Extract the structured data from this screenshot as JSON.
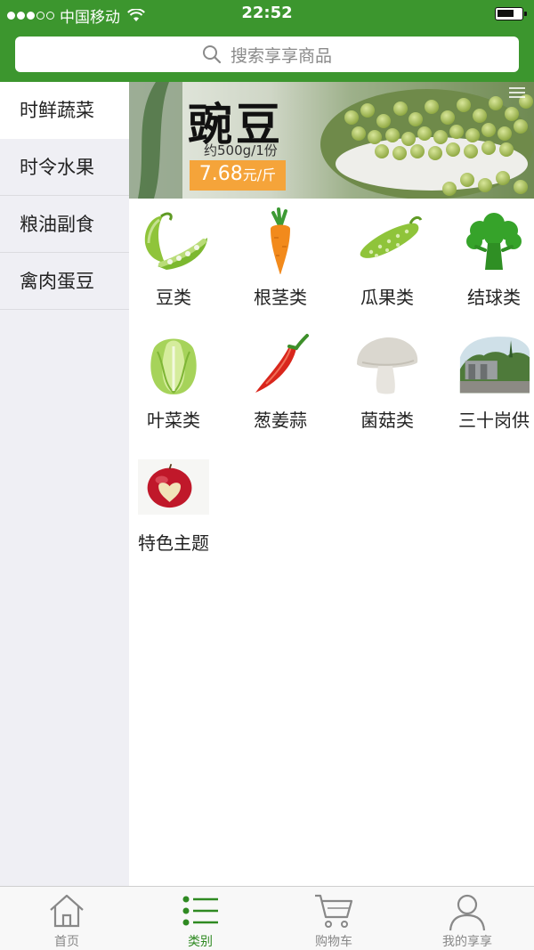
{
  "status_bar": {
    "carrier": "中国移动",
    "time": "22:52"
  },
  "search": {
    "placeholder": "搜索享享商品"
  },
  "sidebar": {
    "items": [
      {
        "label": "时鲜蔬菜",
        "active": true
      },
      {
        "label": "时令水果",
        "active": false
      },
      {
        "label": "粮油副食",
        "active": false
      },
      {
        "label": "禽肉蛋豆",
        "active": false
      }
    ]
  },
  "banner": {
    "title": "豌豆",
    "subtitle": "约500g/1份",
    "price": "7.68",
    "price_unit": "元/斤"
  },
  "categories": [
    {
      "label": "豆类",
      "icon": "pea-pod-icon"
    },
    {
      "label": "根茎类",
      "icon": "carrot-icon"
    },
    {
      "label": "瓜果类",
      "icon": "cucumber-icon"
    },
    {
      "label": "结球类",
      "icon": "broccoli-icon"
    },
    {
      "label": "叶菜类",
      "icon": "cabbage-icon"
    },
    {
      "label": "葱姜蒜",
      "icon": "chili-icon"
    },
    {
      "label": "菌菇类",
      "icon": "mushroom-icon"
    },
    {
      "label": "三十岗供",
      "icon": "village-photo-icon"
    },
    {
      "label": "特色主题",
      "icon": "apple-photo-icon"
    }
  ],
  "tab_bar": {
    "tabs": [
      {
        "label": "首页",
        "icon": "home-icon",
        "active": false
      },
      {
        "label": "类别",
        "icon": "list-icon",
        "active": true
      },
      {
        "label": "购物车",
        "icon": "cart-icon",
        "active": false
      },
      {
        "label": "我的享享",
        "icon": "user-icon",
        "active": false
      }
    ]
  },
  "colors": {
    "brand_green": "#3c962e",
    "tab_active": "#2f8a22",
    "price_orange": "#f5a43a",
    "sidebar_bg": "#efeff4"
  }
}
